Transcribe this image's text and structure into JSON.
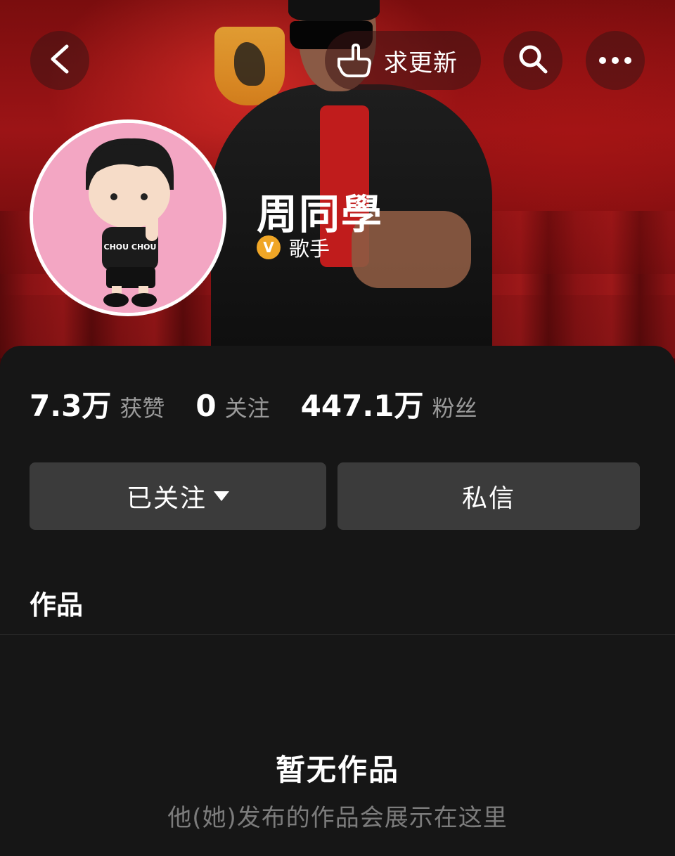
{
  "header": {
    "back_icon": "chevron-left-icon",
    "update_request_label": "求更新",
    "update_request_icon": "pointing-hand-icon",
    "search_icon": "search-icon",
    "more_icon": "more-dots-icon"
  },
  "profile": {
    "name": "周同學",
    "verify_badge": "V",
    "verified_title": "歌手",
    "avatar_shirt_text": "CHOU CHOU",
    "accent_color": "#f0a626"
  },
  "stats": [
    {
      "value": "7.3万",
      "label": "获赞"
    },
    {
      "value": "0",
      "label": "关注"
    },
    {
      "value": "447.1万",
      "label": "粉丝"
    }
  ],
  "actions": {
    "following_label": "已关注",
    "message_label": "私信"
  },
  "works": {
    "tab_label": "作品",
    "empty_title": "暂无作品",
    "empty_subtitle": "他(她)发布的作品会展示在这里"
  }
}
